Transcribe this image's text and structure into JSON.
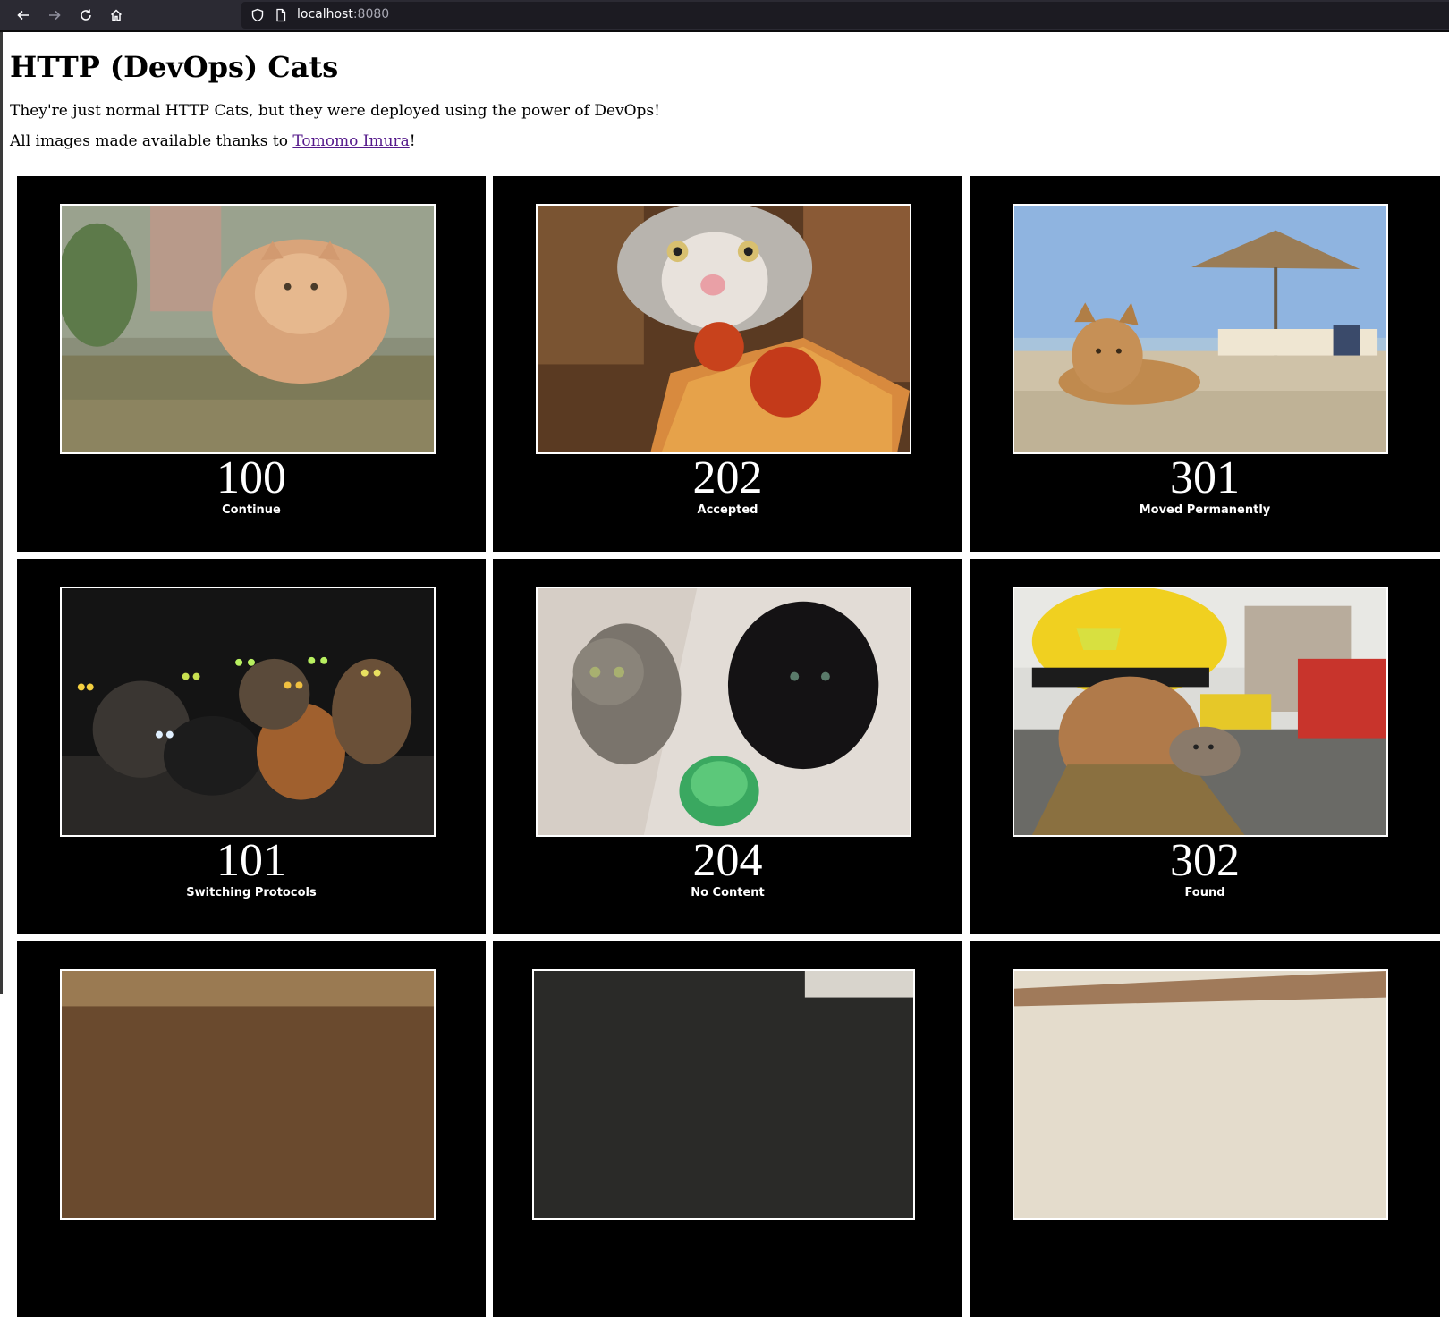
{
  "browser": {
    "url_host": "localhost",
    "url_port": ":8080"
  },
  "page": {
    "title": "HTTP (DevOps) Cats",
    "intro": "They're just normal HTTP Cats, but they were deployed using the power of DevOps!",
    "credit_prefix": "All images made available thanks to ",
    "credit_link": "Tomomo Imura",
    "credit_suffix": "!"
  },
  "cats": [
    {
      "code": "100",
      "label": "Continue"
    },
    {
      "code": "202",
      "label": "Accepted"
    },
    {
      "code": "301",
      "label": "Moved Permanently"
    },
    {
      "code": "101",
      "label": "Switching Protocols"
    },
    {
      "code": "204",
      "label": "No Content"
    },
    {
      "code": "302",
      "label": "Found"
    },
    {
      "code": "",
      "label": ""
    },
    {
      "code": "",
      "label": ""
    },
    {
      "code": "",
      "label": ""
    }
  ],
  "colors": {
    "chrome_bg": "#2b2a33",
    "urlbar_bg": "#1c1b22",
    "tile_bg": "#000000",
    "link_visited": "#551a8b"
  }
}
